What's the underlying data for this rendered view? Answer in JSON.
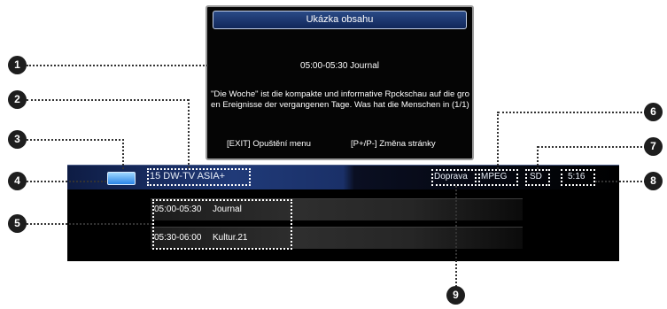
{
  "preview": {
    "title": "Ukázka obsahu",
    "program_time": "05:00-05:30 Journal",
    "description": "\"Die Woche\" ist die kompakte und informative Rpckschau auf die gro en Ereignisse der vergangenen Tage. Was hat die Menschen in  (1/1)",
    "help_exit": "[EXIT] Opuštění menu",
    "help_page": "[P+/P-] Změna stránky"
  },
  "banner": {
    "channel": "15 DW-TV ASIA+",
    "tv_icon": "tv-icon",
    "language": "Doprava",
    "format": "MPEG",
    "definition": "SD",
    "clock": "5:16",
    "epg": [
      {
        "time": "05:00-05:30",
        "title": "Journal"
      },
      {
        "time": "05:30-06:00",
        "title": "Kultur.21"
      }
    ]
  },
  "callouts": [
    "1",
    "2",
    "3",
    "4",
    "5",
    "6",
    "7",
    "8",
    "9"
  ],
  "colors": {
    "accent": "#203a78",
    "callout_bg": "#1e1e1e",
    "banner_bg": "#000000"
  }
}
